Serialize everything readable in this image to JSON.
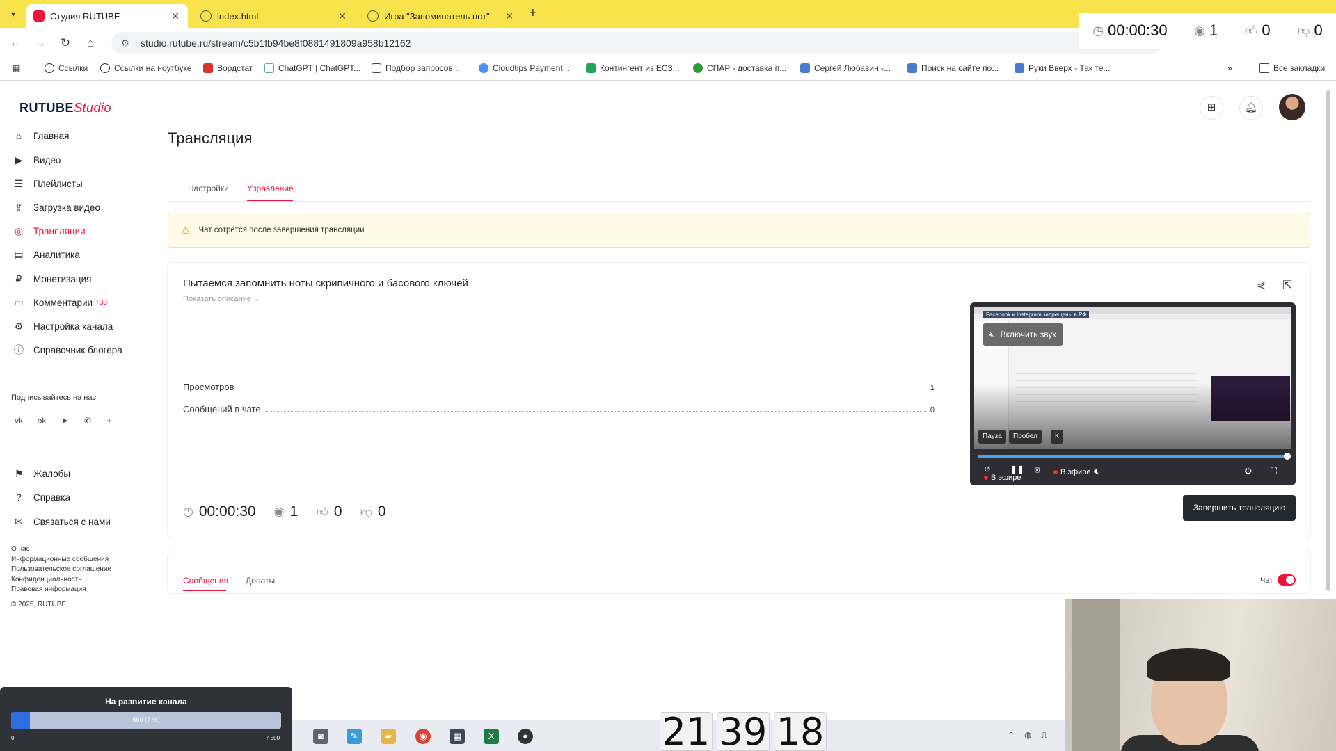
{
  "browser": {
    "tabs": [
      {
        "label": "Студия RUTUBE",
        "active": true
      },
      {
        "label": "index.html",
        "active": false
      },
      {
        "label": "Игра \"Запоминатель нот\"",
        "active": false
      }
    ],
    "url": "studio.rutube.ru/stream/c5b1fb94be8f0881491809a958b12162",
    "bookmarks": [
      "Ссылки",
      "Ссылки на ноутбуке",
      "Вордстат",
      "ChatGPT | ChatGPT...",
      "Подбор запросов...",
      "Cloudtips Payment...",
      "Контингент из ЕСЗ...",
      "СПАР - доставка п...",
      "Сергей Любавин -...",
      "Поиск на сайте по...",
      "Руки Вверх - Так те..."
    ],
    "all_bookmarks": "Все закладки"
  },
  "overlay_stats": {
    "duration": "00:00:30",
    "viewers": "1",
    "likes": "0",
    "dislikes": "0"
  },
  "studio": {
    "logo_main": "RUTUBE",
    "logo_studio": "Studio",
    "sidebar": [
      {
        "label": "Главная",
        "icon": "home-icon"
      },
      {
        "label": "Видео",
        "icon": "video-icon"
      },
      {
        "label": "Плейлисты",
        "icon": "playlist-icon"
      },
      {
        "label": "Загрузка видео",
        "icon": "upload-icon"
      },
      {
        "label": "Трансляции",
        "icon": "broadcast-icon",
        "active": true
      },
      {
        "label": "Аналитика",
        "icon": "analytics-icon"
      },
      {
        "label": "Монетизация",
        "icon": "money-icon"
      },
      {
        "label": "Комментарии",
        "icon": "comment-icon",
        "badge": "+33"
      },
      {
        "label": "Настройка канала",
        "icon": "settings-icon"
      },
      {
        "label": "Справочник блогера",
        "icon": "guide-icon"
      }
    ],
    "subscribe_title": "Подписывайтесь на нас",
    "social": [
      "vk",
      "ok",
      "telegram",
      "viber",
      "plus"
    ],
    "sidebar_bottom": [
      {
        "label": "Жалобы",
        "icon": "flag-icon"
      },
      {
        "label": "Справка",
        "icon": "help-icon"
      },
      {
        "label": "Связаться с нами",
        "icon": "mail-icon"
      }
    ],
    "footer_links": [
      "О нас",
      "Информационные сообщения",
      "Пользовательское соглашение",
      "Конфиденциальность",
      "Правовая информация",
      "© 2025, RUTUBE"
    ],
    "page_title": "Трансляция",
    "tabs": [
      "Настройки",
      "Управление"
    ],
    "notice": "Чат сотрётся после завершения трансляции",
    "stream": {
      "title": "Пытаемся запомнить ноты скрипичного и басового ключей",
      "show_description": "Показать описание",
      "views_label": "Просмотров",
      "views_value": "1",
      "messages_label": "Сообщений в чате",
      "messages_value": "0",
      "duration": "00:00:30",
      "viewers": "1",
      "likes": "0",
      "dislikes": "0"
    },
    "player": {
      "banner": "Facebook и Instagram запрещены в РФ",
      "unmute": "Включить звук",
      "hints": [
        "Пауза",
        "Пробел",
        "К"
      ],
      "live": "В эфире",
      "progress": 0.99
    },
    "end_stream": "Завершить трансляцию",
    "chat_tabs": [
      "Сообщения",
      "Донаты"
    ],
    "chat_toggle_label": "Чат"
  },
  "donation": {
    "title": "На развитие канала",
    "value_label": "550 (7 %)",
    "min": "0",
    "max": "7 500",
    "fraction": 0.07
  },
  "clock": [
    "21",
    "39",
    "18"
  ]
}
